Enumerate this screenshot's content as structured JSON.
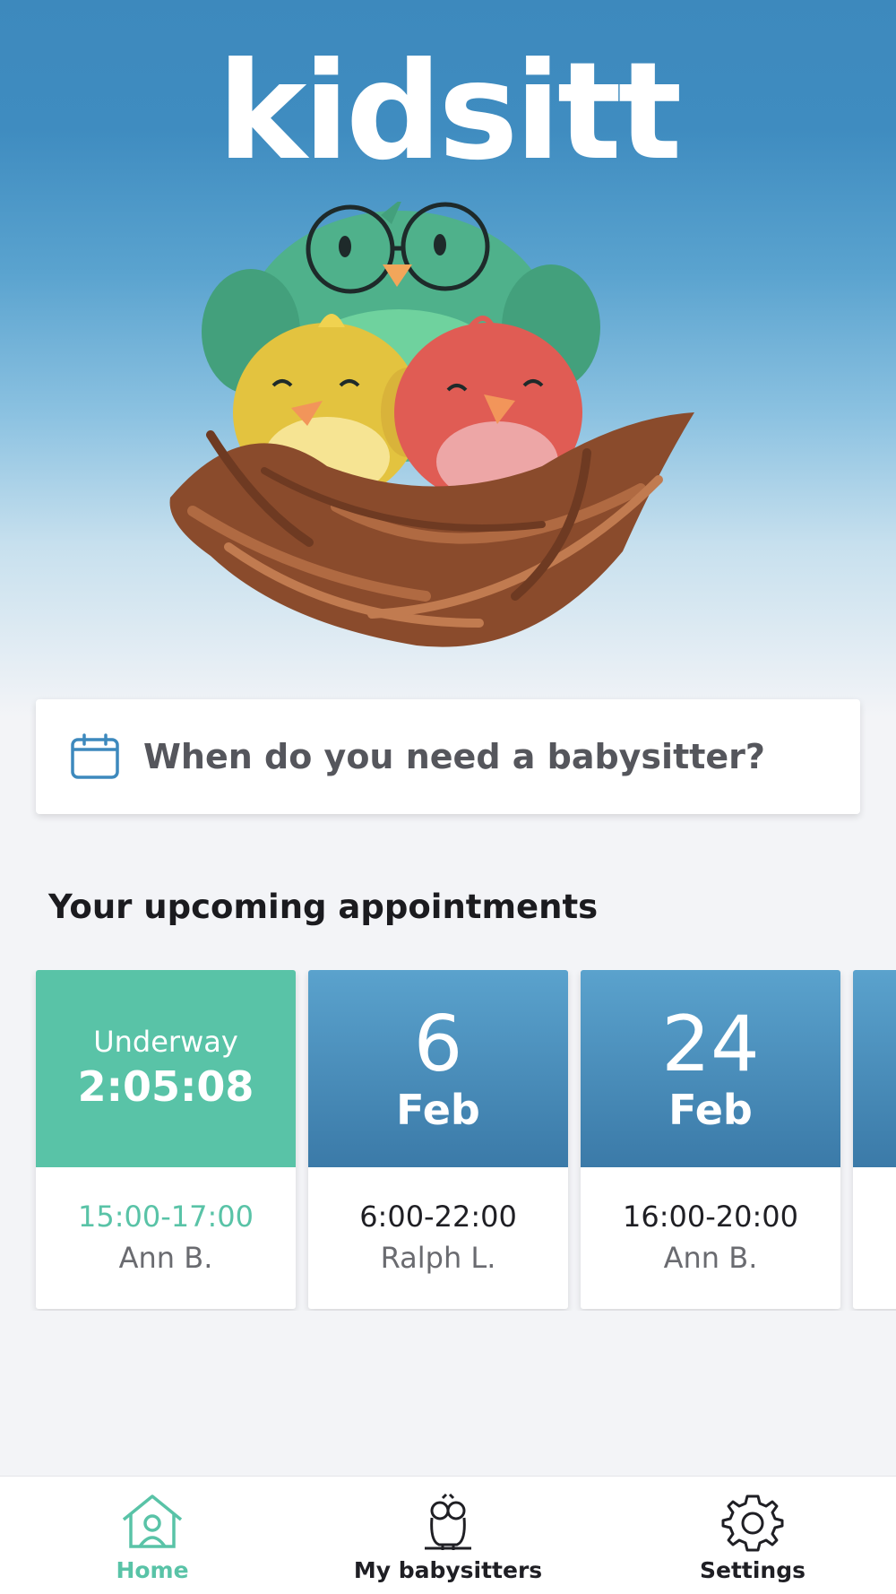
{
  "app": {
    "logo_text": "kidsitt"
  },
  "search": {
    "prompt": "When do you need a babysitter?",
    "icon": "calendar-icon"
  },
  "appointments_section": {
    "title": "Your upcoming appointments",
    "items": [
      {
        "status": "Underway",
        "timer": "2:05:08",
        "time": "15:00-17:00",
        "sitter": "Ann B.",
        "state": "active"
      },
      {
        "day": "6",
        "month": "Feb",
        "time": "6:00-22:00",
        "sitter": "Ralph L.",
        "state": "upcoming"
      },
      {
        "day": "24",
        "month": "Feb",
        "time": "16:00-20:00",
        "sitter": "Ann B.",
        "state": "upcoming"
      }
    ]
  },
  "tabbar": {
    "tabs": [
      {
        "label": "Home",
        "icon": "home-icon",
        "active": true
      },
      {
        "label": "My babysitters",
        "icon": "owl-icon",
        "active": false
      },
      {
        "label": "Settings",
        "icon": "gear-icon",
        "active": false
      }
    ]
  },
  "colors": {
    "accent_green": "#59c3a7",
    "brand_blue": "#3d89bd"
  }
}
